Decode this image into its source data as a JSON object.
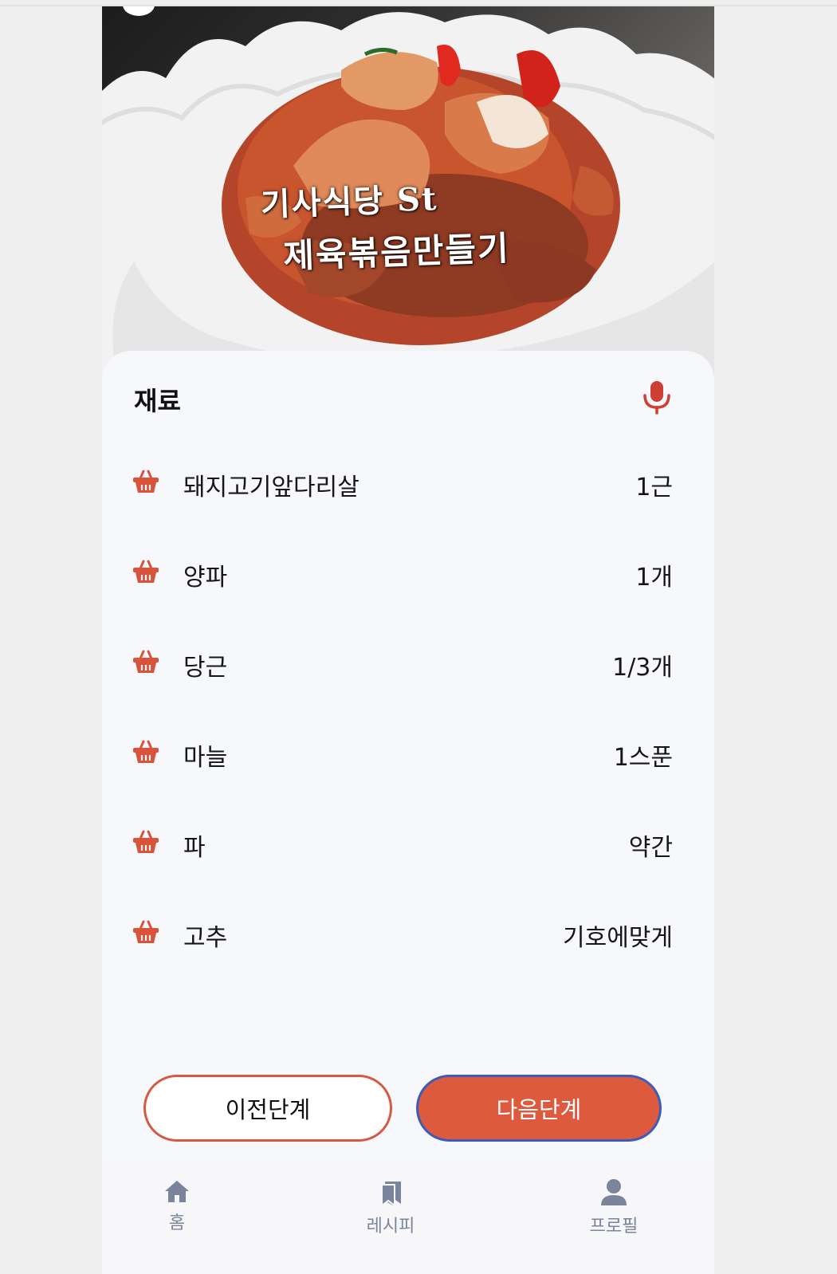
{
  "hero": {
    "caption_line1": "기사식당 St",
    "caption_line2": "제육볶음만들기"
  },
  "section": {
    "title": "재료",
    "mic_icon": "microphone-icon"
  },
  "ingredients": [
    {
      "name": "돼지고기앞다리살",
      "qty": "1근",
      "icon": "basket-icon"
    },
    {
      "name": "양파",
      "qty": "1개",
      "icon": "basket-icon"
    },
    {
      "name": "당근",
      "qty": "1/3개",
      "icon": "basket-icon"
    },
    {
      "name": "마늘",
      "qty": "1스푼",
      "icon": "basket-icon"
    },
    {
      "name": "파",
      "qty": "약간",
      "icon": "basket-icon"
    },
    {
      "name": "고추",
      "qty": "기호에맞게",
      "icon": "basket-icon"
    }
  ],
  "buttons": {
    "prev": "이전단계",
    "next": "다음단계"
  },
  "tabbar": {
    "home": {
      "label": "홈",
      "icon": "home-icon"
    },
    "recipe": {
      "label": "레시피",
      "icon": "bookmark-icon"
    },
    "profile": {
      "label": "프로필",
      "icon": "user-icon"
    }
  },
  "colors": {
    "accent": "#dd5a3f",
    "accent_border": "#d65a43",
    "focus_ring": "#3d5bb8",
    "tab_icon": "#7a849a",
    "background": "#f7f8fc"
  }
}
